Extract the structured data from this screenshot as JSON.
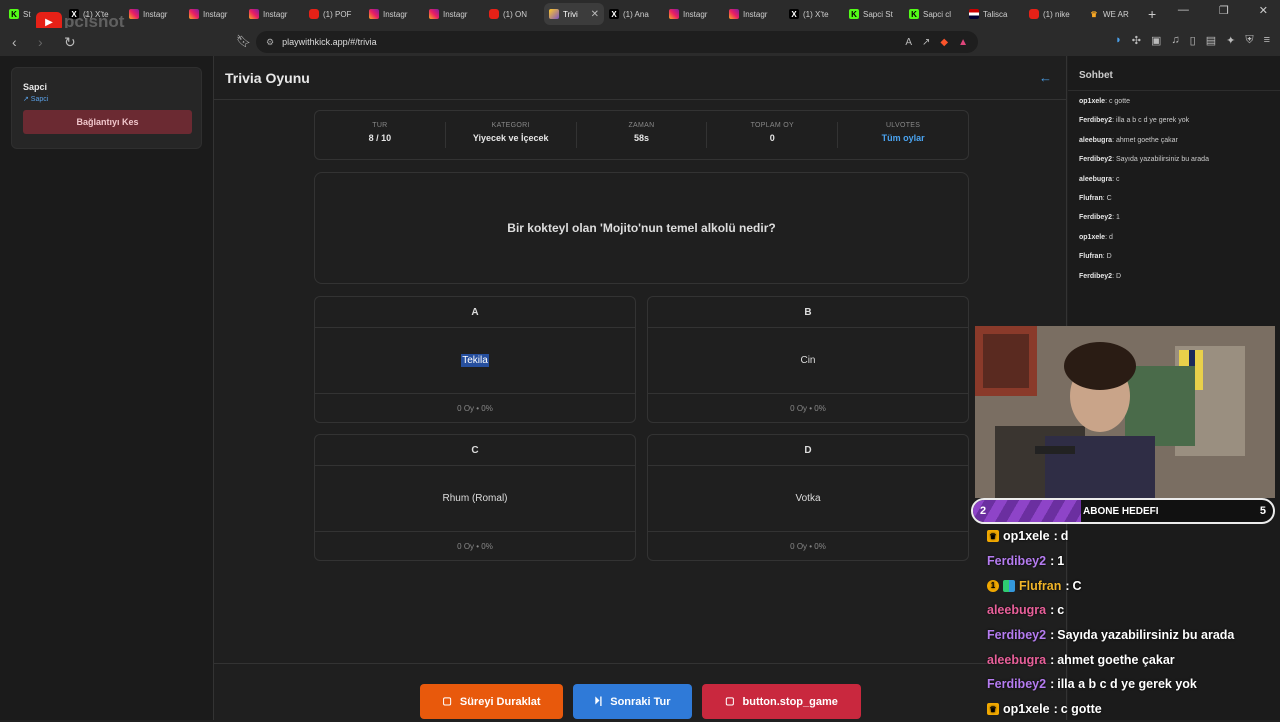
{
  "browser": {
    "tabs": [
      {
        "icon": "kick",
        "label": "St"
      },
      {
        "icon": "x",
        "label": "(1) X'te"
      },
      {
        "icon": "instagram",
        "label": "Instagr"
      },
      {
        "icon": "instagram",
        "label": "Instagr"
      },
      {
        "icon": "instagram",
        "label": "Instagr"
      },
      {
        "icon": "youtube",
        "label": "(1) POF"
      },
      {
        "icon": "instagram",
        "label": "Instagr"
      },
      {
        "icon": "instagram",
        "label": "Instagr"
      },
      {
        "icon": "youtube",
        "label": "(1) ON"
      },
      {
        "icon": "trivia",
        "label": "Trivi",
        "active": true
      },
      {
        "icon": "x",
        "label": "(1) Ana"
      },
      {
        "icon": "instagram",
        "label": "Instagr"
      },
      {
        "icon": "instagram",
        "label": "Instagr"
      },
      {
        "icon": "x",
        "label": "(1) X'te"
      },
      {
        "icon": "kick",
        "label": "Sapci St"
      },
      {
        "icon": "kick",
        "label": "Sapci cl"
      },
      {
        "icon": "flag",
        "label": "Talisca"
      },
      {
        "icon": "youtube",
        "label": "(1) nike"
      },
      {
        "icon": "crown",
        "label": "WE AR"
      }
    ],
    "url": "playwithkick.app/#/trivia",
    "watermark": "pcisnot"
  },
  "connection": {
    "name": "Sapci",
    "sub": "↗ Sapci",
    "disconnect_label": "Bağlantıyı Kes"
  },
  "page": {
    "title": "Trivia Oyunu"
  },
  "stats": [
    {
      "label": "TUR",
      "value": "8 / 10"
    },
    {
      "label": "KATEGORI",
      "value": "Yiyecek ve İçecek"
    },
    {
      "label": "ZAMAN",
      "value": "58s"
    },
    {
      "label": "TOPLAM OY",
      "value": "0"
    },
    {
      "label": "ULVOTES",
      "value": "Tüm oylar"
    }
  ],
  "question": "Bir kokteyl olan 'Mojito'nun temel alkolü nedir?",
  "options": [
    {
      "letter": "A",
      "text": "Tekila",
      "votes": "0 Oy • 0%"
    },
    {
      "letter": "B",
      "text": "Cin",
      "votes": "0 Oy • 0%"
    },
    {
      "letter": "C",
      "text": "Rhum (Romal)",
      "votes": "0 Oy • 0%"
    },
    {
      "letter": "D",
      "text": "Votka",
      "votes": "0 Oy • 0%"
    }
  ],
  "controls": {
    "pause_label": "Süreyi Duraklat",
    "next_label": "Sonraki Tur",
    "stop_label": "button.stop_game"
  },
  "chat": {
    "title": "Sohbet",
    "messages": [
      {
        "user": "op1xele",
        "text": "c gotte"
      },
      {
        "user": "Ferdibey2",
        "text": "illa a b c d ye gerek yok"
      },
      {
        "user": "aleebugra",
        "text": "ahmet goethe çakar"
      },
      {
        "user": "Ferdibey2",
        "text": "Sayıda yazabilirsiniz bu arada"
      },
      {
        "user": "aleebugra",
        "text": "c"
      },
      {
        "user": "Flufran",
        "text": "C"
      },
      {
        "user": "Ferdibey2",
        "text": "1"
      },
      {
        "user": "op1xele",
        "text": "d"
      },
      {
        "user": "Flufran",
        "text": "D"
      },
      {
        "user": "Ferdibey2",
        "text": "D"
      }
    ]
  },
  "stream_overlay": {
    "sub_goal": {
      "current": "2",
      "label": "ABONE HEDEFI",
      "target": "5"
    },
    "messages": [
      {
        "user": "op1xele",
        "text": "d",
        "color": "#ffffff",
        "badge": "crown"
      },
      {
        "user": "Ferdibey2",
        "text": "1",
        "color": "#b57cf0",
        "badge": ""
      },
      {
        "user": "Flufran",
        "text": "C",
        "color": "#f0b429",
        "badge": "multi"
      },
      {
        "user": "aleebugra",
        "text": "c",
        "color": "#e8609a",
        "badge": ""
      },
      {
        "user": "Ferdibey2",
        "text": "Sayıda yazabilirsiniz bu arada",
        "color": "#b57cf0",
        "badge": ""
      },
      {
        "user": "aleebugra",
        "text": "ahmet goethe çakar",
        "color": "#e8609a",
        "badge": ""
      },
      {
        "user": "Ferdibey2",
        "text": "illa a b c d ye gerek yok",
        "color": "#b57cf0",
        "badge": ""
      },
      {
        "user": "op1xele",
        "text": "c gotte",
        "color": "#ffffff",
        "badge": "crown"
      }
    ]
  }
}
